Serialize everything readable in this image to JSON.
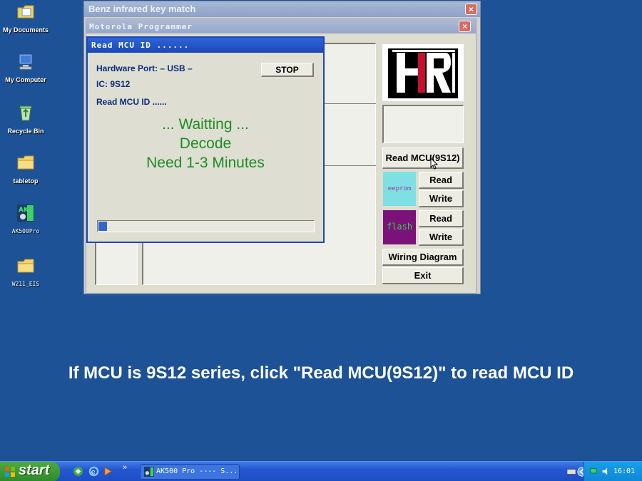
{
  "desktop": {
    "icons": [
      {
        "label": "My Documents"
      },
      {
        "label": "My Computer"
      },
      {
        "label": "Recycle Bin"
      },
      {
        "label": "tabletop"
      },
      {
        "label": "AK500Pro"
      },
      {
        "label": "W211_EIS"
      }
    ]
  },
  "back_window": {
    "title": "Benz infrared key match",
    "close": "×"
  },
  "programmer_window": {
    "title": "Motorola Programmer",
    "close": "×",
    "logo_text": "HRI",
    "buttons": {
      "read_mcu": "Read MCU(9S12)",
      "eeprom_read": "Read",
      "eeprom_write": "Write",
      "flash_read": "Read",
      "flash_write": "Write",
      "wiring": "Wiring Diagram",
      "exit": "Exit"
    },
    "chips": {
      "eeprom": "eeprom",
      "flash": "flash"
    },
    "colors": {
      "eeprom": "#7fe0e4",
      "flash": "#7a127a"
    }
  },
  "dialog": {
    "title": "Read MCU ID ......",
    "hardware_port": "Hardware Port: – USB –",
    "ic": "IC: 9S12",
    "status_small": "Read MCU ID ......",
    "stop": "STOP",
    "line1": "... Waitting ...",
    "line2": "Decode",
    "line3": "Need 1-3 Minutes",
    "progress_fraction": 0.04
  },
  "caption": "If MCU is 9S12 series, click \"Read MCU(9S12)\" to read MCU ID",
  "taskbar": {
    "start": "start",
    "quick_more": "»",
    "task_label": "AK500 Pro ---- S...",
    "clock": "16:01"
  }
}
